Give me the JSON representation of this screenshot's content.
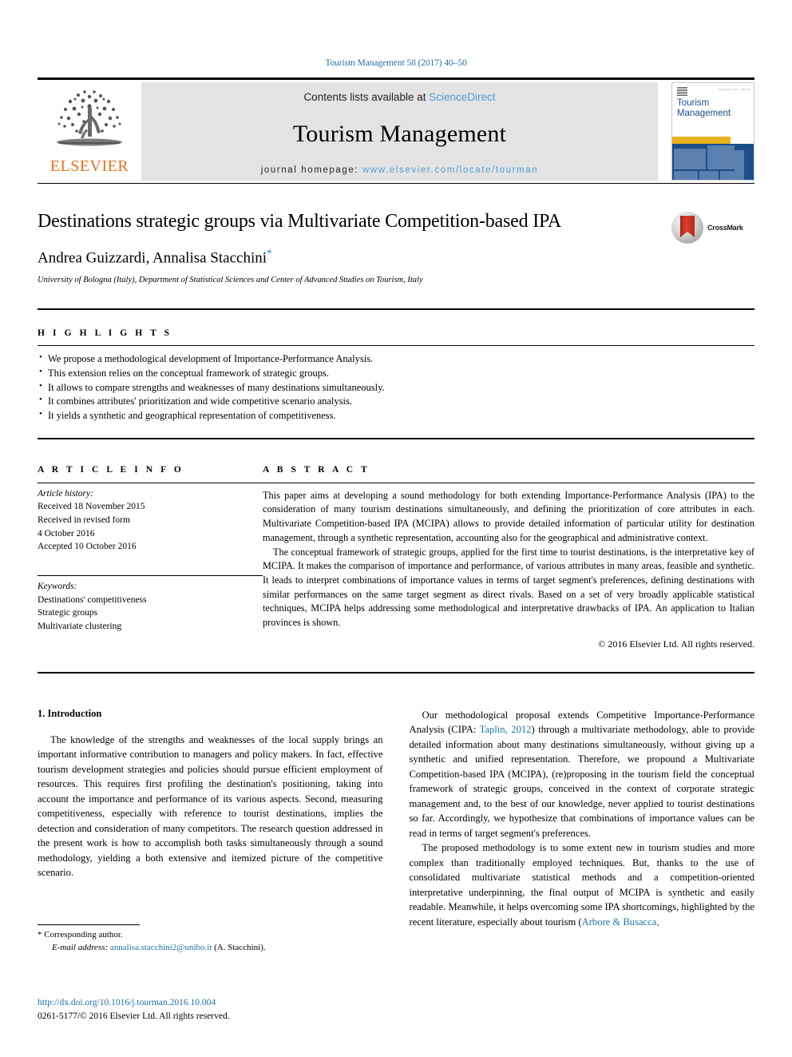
{
  "running_head": "Tourism Management 58 (2017) 40–50",
  "masthead": {
    "publisher_name": "ELSEVIER",
    "contents_prefix": "Contents lists available at ",
    "contents_link": "ScienceDirect",
    "journal_title": "Tourism Management",
    "homepage_prefix": "journal homepage: ",
    "homepage_url": "www.elsevier.com/locate/tourman",
    "cover": {
      "line1": "Tourism",
      "line2": "Management"
    }
  },
  "title_block": {
    "title": "Destinations strategic groups via Multivariate Competition-based IPA",
    "authors": "Andrea Guizzardi, Annalisa Stacchini",
    "corresponding_marker": "*",
    "affiliation": "University of Bologna (Italy), Department of Statistical Sciences and Center of Advanced Studies on Tourism, Italy",
    "crossmark_label": "CrossMark"
  },
  "highlights": {
    "heading": "H I G H L I G H T S",
    "items": [
      "We propose a methodological development of Importance-Performance Analysis.",
      "This extension relies on the conceptual framework of strategic groups.",
      "It allows to compare strengths and weaknesses of many destinations simultaneously.",
      "It combines attributes' prioritization and wide competitive scenario analysis.",
      "It yields a synthetic and geographical representation of competitiveness."
    ]
  },
  "article_info": {
    "heading": "A R T I C L E   I N F O",
    "history_label": "Article history:",
    "history_lines": [
      "Received 18 November 2015",
      "Received in revised form",
      "4 October 2016",
      "Accepted 10 October 2016"
    ],
    "keywords_label": "Keywords:",
    "keywords": [
      "Destinations' competitiveness",
      "Strategic groups",
      "Multivariate clustering"
    ]
  },
  "abstract": {
    "heading": "A B S T R A C T",
    "paragraphs": [
      "This paper aims at developing a sound methodology for both extending Importance-Performance Analysis (IPA) to the consideration of many tourism destinations simultaneously, and defining the prioritization of core attributes in each. Multivariate Competition-based IPA (MCIPA) allows to provide detailed information of particular utility for destination management, through a synthetic representation, accounting also for the geographical and administrative context.",
      "The conceptual framework of strategic groups, applied for the first time to tourist destinations, is the interpretative key of MCIPA. It makes the comparison of importance and performance, of various attributes in many areas, feasible and synthetic. It leads to interpret combinations of importance values in terms of target segment's preferences, defining destinations with similar performances on the same target segment as direct rivals. Based on a set of very broadly applicable statistical techniques, MCIPA helps addressing some methodological and interpretative drawbacks of IPA. An application to Italian provinces is shown."
    ],
    "copyright": "© 2016 Elsevier Ltd. All rights reserved."
  },
  "body": {
    "section_number_title": "1. Introduction",
    "left_paragraphs": [
      "The knowledge of the strengths and weaknesses of the local supply brings an important informative contribution to managers and policy makers. In fact, effective tourism development strategies and policies should pursue efficient employment of resources. This requires first profiling the destination's positioning, taking into account the importance and performance of its various aspects. Second, measuring competitiveness, especially with reference to tourist destinations, implies the detection and consideration of many competitors. The research question addressed in the present work is how to accomplish both tasks simultaneously through a sound methodology, yielding a both extensive and itemized picture of the competitive scenario."
    ],
    "right_paragraph_1_pre": "Our methodological proposal extends Competitive Importance-Performance Analysis (CIPA: ",
    "right_paragraph_1_cite": "Taplin, 2012",
    "right_paragraph_1_post": ") through a multivariate methodology, able to provide detailed information about many destinations simultaneously, without giving up a synthetic and unified representation. Therefore, we propound a Multivariate Competition-based IPA (MCIPA), (re)proposing in the tourism field the conceptual framework of strategic groups, conceived in the context of corporate strategic management and, to the best of our knowledge, never applied to tourist destinations so far. Accordingly, we hypothesize that combinations of importance values can be read in terms of target segment's preferences.",
    "right_paragraph_2_pre": "The proposed methodology is to some extent new in tourism studies and more complex than traditionally employed techniques. But, thanks to the use of consolidated multivariate statistical methods and a competition-oriented interpretative underpinning, the final output of MCIPA is synthetic and easily readable. Meanwhile, it helps overcoming some IPA shortcomings, highlighted by the recent literature, especially about tourism (",
    "right_paragraph_2_cite": "Arbore & Busacca,"
  },
  "footnote": {
    "corresponding": "* Corresponding author.",
    "email_label": "E-mail address:",
    "email": "annalisa.stacchini2@unibo.it",
    "email_suffix": " (A. Stacchini)."
  },
  "doi_block": {
    "doi": "http://dx.doi.org/10.1016/j.tourman.2016.10.004",
    "issn_line": "0261-5177/© 2016 Elsevier Ltd. All rights reserved."
  },
  "colors": {
    "link": "#1f72a8",
    "sciencedirect": "#4f9dd4",
    "elsevier_orange": "#e8711a",
    "cover_blue": "#1b4f8a",
    "cover_yellow": "#e8b21d",
    "crossmark_red": "#b8291b"
  }
}
